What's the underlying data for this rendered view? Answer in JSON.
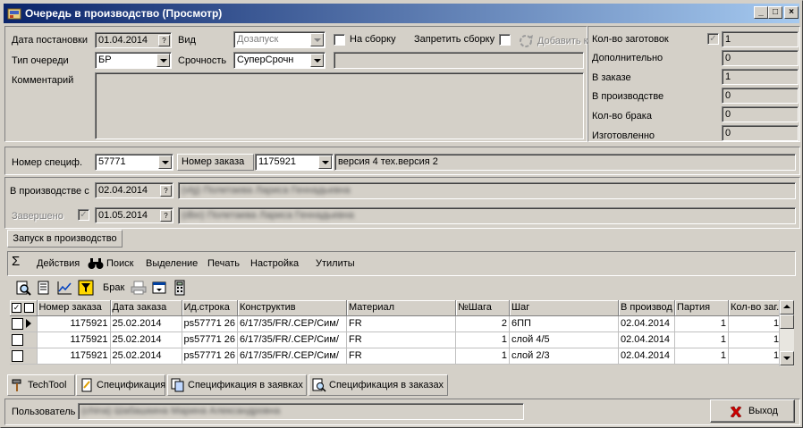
{
  "window": {
    "title": "Очередь в производство (Просмотр)"
  },
  "header": {
    "date_label": "Дата постановки",
    "date_value": "01.04.2014",
    "kind_label": "Вид",
    "kind_value": "Дозапуск",
    "assembly_label": "На сборку",
    "forbid_assembly_label": "Запретить сборку",
    "add_label": "Добавить к",
    "queue_type_label": "Тип очереди",
    "queue_type_value": "БР",
    "urgency_label": "Срочность",
    "urgency_value": "СуперСрочн",
    "comment_label": "Комментарий"
  },
  "counts": {
    "blanks_label": "Кол-во заготовок",
    "blanks_value": "1",
    "additional_label": "Дополнительно",
    "additional_value": "0",
    "in_order_label": "В заказе",
    "in_order_value": "1",
    "in_production_label": "В производстве",
    "in_production_value": "0",
    "defect_label": "Кол-во брака",
    "defect_value": "0",
    "made_label": "Изготовленно",
    "made_value": "0"
  },
  "spec": {
    "spec_number_label": "Номер специф.",
    "spec_number_value": "57771",
    "order_number_label": "Номер заказа",
    "order_number_value": "1175921",
    "version_text": "версия 4 тех.версия 2"
  },
  "production": {
    "in_production_label": "В производстве с",
    "in_production_date": "02.04.2014",
    "in_production_user": "(vlg) Полетаева Лариса Геннадьевна",
    "completed_label": "Завершено",
    "completed_date": "01.05.2014",
    "completed_user": "(dbo) Полетаева Лариса Геннадьевна",
    "launch_tab": "Запуск в производство"
  },
  "menu": {
    "sum_symbol": "Σ",
    "actions": "Действия",
    "search": "Поиск",
    "selection": "Выделение",
    "print": "Печать",
    "settings": "Настройка",
    "utilities": "Утилиты",
    "defect_button": "Брак"
  },
  "grid": {
    "columns": [
      "Номер заказа",
      "Дата заказа",
      "Ид.строка",
      "Конструктив",
      "Материал",
      "№Шага",
      "Шаг",
      "В производ",
      "Партия",
      "Кол-во заг."
    ],
    "rows": [
      [
        "1175921",
        "25.02.2014",
        "ps57771 26",
        "6/17/35/FR/.CEP/Сим/",
        "FR",
        "2",
        "6ПП",
        "02.04.2014",
        "1",
        "1"
      ],
      [
        "1175921",
        "25.02.2014",
        "ps57771 26",
        "6/17/35/FR/.CEP/Сим/",
        "FR",
        "1",
        "слой 4/5",
        "02.04.2014",
        "1",
        "1"
      ],
      [
        "1175921",
        "25.02.2014",
        "ps57771 26",
        "6/17/35/FR/.CEP/Сим/",
        "FR",
        "1",
        "слой 2/3",
        "02.04.2014",
        "1",
        "1"
      ]
    ]
  },
  "tabs": {
    "techtool": "TechTool",
    "specification": "Спецификация",
    "spec_in_requests": "Спецификация в заявках",
    "spec_in_orders": "Спецификация в заказах"
  },
  "footer": {
    "user_label": "Пользователь",
    "user_value": "(china) Шабашкина Марина Александровна",
    "exit_label": "Выход"
  },
  "colors": {
    "title_start": "#0a246a",
    "title_end": "#a6caf0",
    "face": "#d4d0c8",
    "exit_icon": "#cc0000"
  }
}
